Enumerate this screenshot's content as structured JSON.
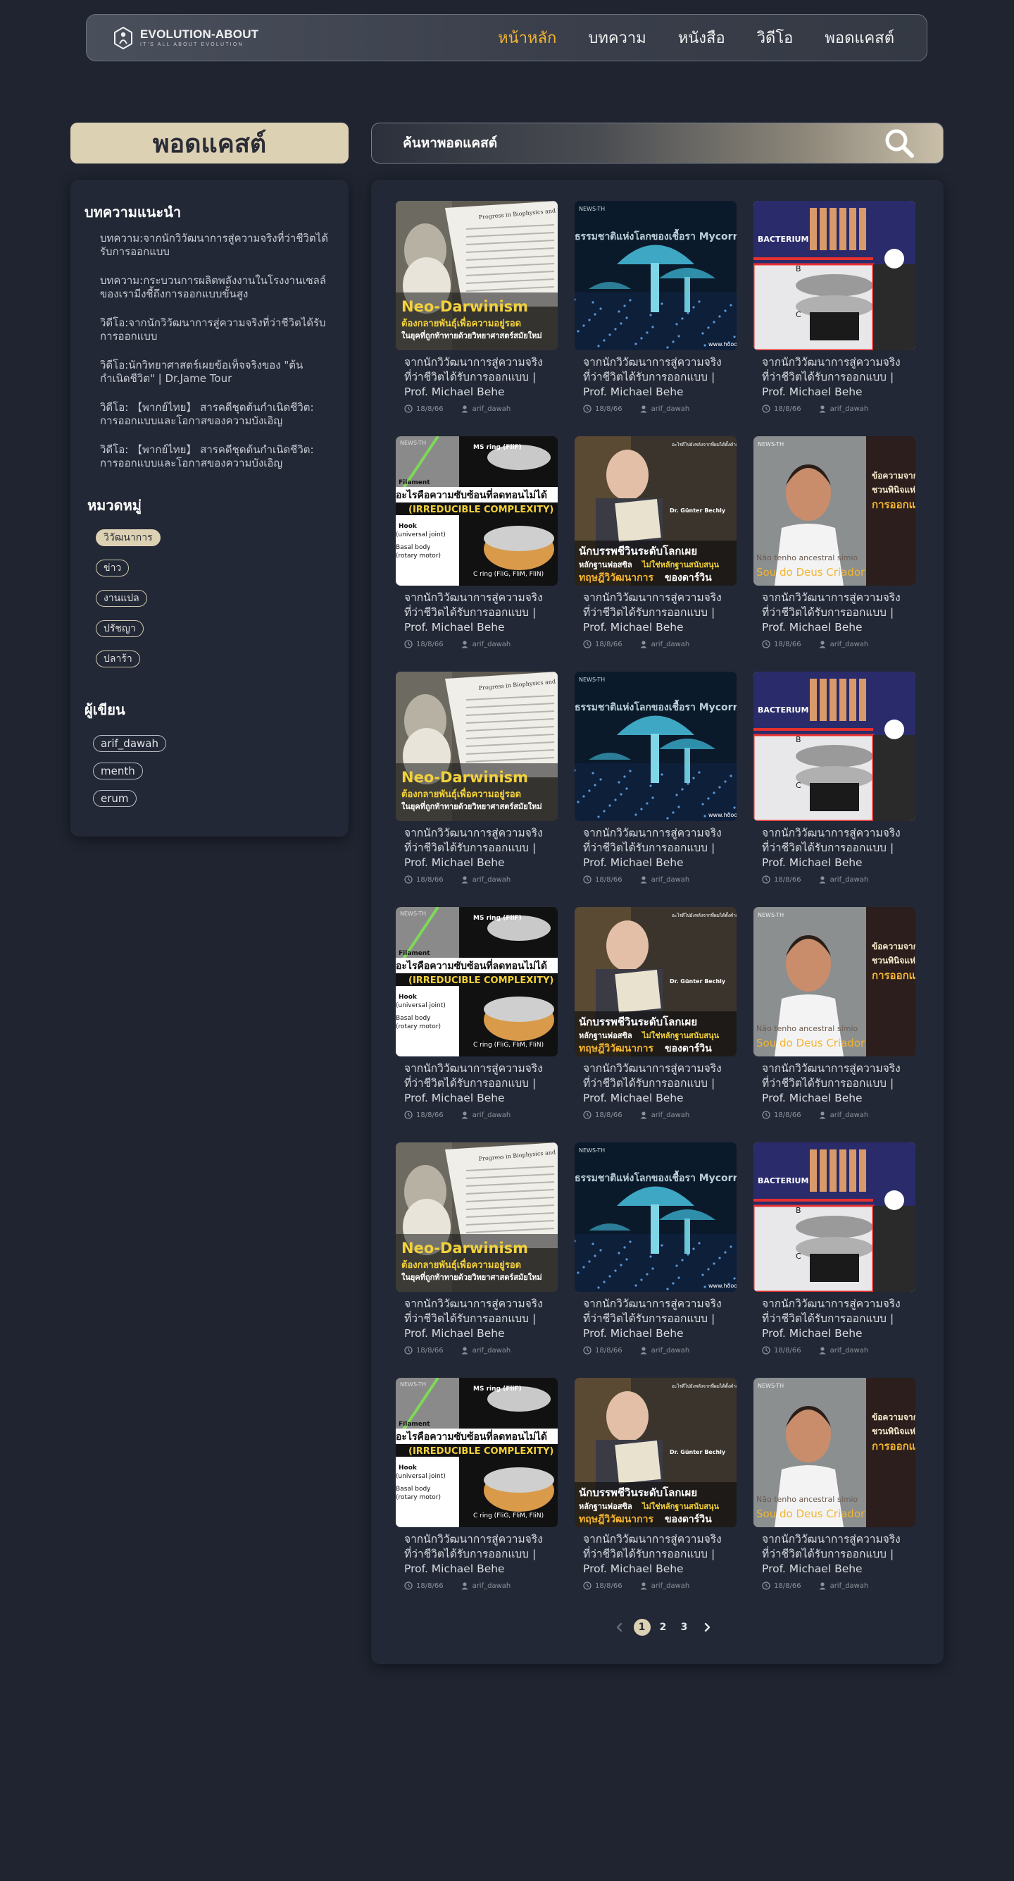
{
  "nav": {
    "logo_name": "EVOLUTION-ABOUT",
    "logo_tagline": "IT'S ALL ABOUT EVOLUTION",
    "links": [
      {
        "label": "หน้าหลัก",
        "active": true
      },
      {
        "label": "บทความ",
        "active": false
      },
      {
        "label": "หนังสือ",
        "active": false
      },
      {
        "label": "วิดีโอ",
        "active": false
      },
      {
        "label": "พอดแคสต์",
        "active": false
      }
    ],
    "active_color": "#f2b431"
  },
  "page": {
    "heading": "พอดแคสต์"
  },
  "search": {
    "placeholder": "ค้นหาพอดแคสต์",
    "icon": "search-icon"
  },
  "sidebar": {
    "recommended_title": "บทความแนะนำ",
    "recommended": [
      "บทความ:จากนักวิวัฒนาการสู่ความจริงที่ว่าชีวิตได้รับการออกแบบ",
      "บทความ:กระบวนการผลิตพลังงานในโรงงานเซลล์ของเรามีงชี้ถึงการออกแบบขั้นสูง",
      "วิดีโอ:จากนักวิวัฒนาการสู่ความจริงที่ว่าชีวิตได้รับการออกแบบ",
      "วิดีโอ:นักวิทยาศาสตร์เผยข้อเท็จจริงของ \"ต้นกำเนิดชีวิต\" | Dr.Jame Tour",
      "วิดีโอ: 【พากย์ไทย】 สารคดีชุดต้นกำเนิดชีวิต: การออกแบบและโอกาสของความบังเอิญ",
      "วิดีโอ: 【พากย์ไทย】 สารคดีชุดต้นกำเนิดชีวิต: การออกแบบและโอกาสของความบังเอิญ"
    ],
    "categories_title": "หมวดหมู่",
    "categories": [
      {
        "label": "วิวัฒนาการ",
        "active": true
      },
      {
        "label": "ข่าว",
        "active": false
      },
      {
        "label": "งานแปล",
        "active": false
      },
      {
        "label": "ปรัชญา",
        "active": false
      },
      {
        "label": "ปลาร้า",
        "active": false
      }
    ],
    "authors_title": "ผู้เขียน",
    "authors": [
      "arif_dawah",
      "menth",
      "erum"
    ],
    "accent_color": "#ddd1b4"
  },
  "cards": [
    {
      "thumb": "darwin",
      "title": "จากนักวิวัฒนาการสู่ความจริงที่ว่าชีวิตได้รับการออกแบบ | Prof. Michael Behe",
      "date": "18/8/66",
      "author": "arif_dawah"
    },
    {
      "thumb": "mushroom",
      "title": "จากนักวิวัฒนาการสู่ความจริงที่ว่าชีวิตได้รับการออกแบบ | Prof. Michael Behe",
      "date": "18/8/66",
      "author": "arif_dawah"
    },
    {
      "thumb": "bacterium",
      "title": "จากนักวิวัฒนาการสู่ความจริงที่ว่าชีวิตได้รับการออกแบบ | Prof. Michael Behe",
      "date": "18/8/66",
      "author": "arif_dawah"
    },
    {
      "thumb": "motor",
      "title": "จากนักวิวัฒนาการสู่ความจริงที่ว่าชีวิตได้รับการออกแบบ | Prof. Michael Behe",
      "date": "18/8/66",
      "author": "arif_dawah"
    },
    {
      "thumb": "bechly",
      "title": "จากนักวิวัฒนาการสู่ความจริงที่ว่าชีวิตได้รับการออกแบบ | Prof. Michael Behe",
      "date": "18/8/66",
      "author": "arif_dawah"
    },
    {
      "thumb": "doctor",
      "title": "จากนักวิวัฒนาการสู่ความจริงที่ว่าชีวิตได้รับการออกแบบ | Prof. Michael Behe",
      "date": "18/8/66",
      "author": "arif_dawah"
    },
    {
      "thumb": "darwin",
      "title": "จากนักวิวัฒนาการสู่ความจริงที่ว่าชีวิตได้รับการออกแบบ | Prof. Michael Behe",
      "date": "18/8/66",
      "author": "arif_dawah"
    },
    {
      "thumb": "mushroom",
      "title": "จากนักวิวัฒนาการสู่ความจริงที่ว่าชีวิตได้รับการออกแบบ | Prof. Michael Behe",
      "date": "18/8/66",
      "author": "arif_dawah"
    },
    {
      "thumb": "bacterium",
      "title": "จากนักวิวัฒนาการสู่ความจริงที่ว่าชีวิตได้รับการออกแบบ | Prof. Michael Behe",
      "date": "18/8/66",
      "author": "arif_dawah"
    },
    {
      "thumb": "motor",
      "title": "จากนักวิวัฒนาการสู่ความจริงที่ว่าชีวิตได้รับการออกแบบ | Prof. Michael Behe",
      "date": "18/8/66",
      "author": "arif_dawah"
    },
    {
      "thumb": "bechly",
      "title": "จากนักวิวัฒนาการสู่ความจริงที่ว่าชีวิตได้รับการออกแบบ | Prof. Michael Behe",
      "date": "18/8/66",
      "author": "arif_dawah"
    },
    {
      "thumb": "doctor",
      "title": "จากนักวิวัฒนาการสู่ความจริงที่ว่าชีวิตได้รับการออกแบบ | Prof. Michael Behe",
      "date": "18/8/66",
      "author": "arif_dawah"
    },
    {
      "thumb": "darwin",
      "title": "จากนักวิวัฒนาการสู่ความจริงที่ว่าชีวิตได้รับการออกแบบ | Prof. Michael Behe",
      "date": "18/8/66",
      "author": "arif_dawah"
    },
    {
      "thumb": "mushroom",
      "title": "จากนักวิวัฒนาการสู่ความจริงที่ว่าชีวิตได้รับการออกแบบ | Prof. Michael Behe",
      "date": "18/8/66",
      "author": "arif_dawah"
    },
    {
      "thumb": "bacterium",
      "title": "จากนักวิวัฒนาการสู่ความจริงที่ว่าชีวิตได้รับการออกแบบ | Prof. Michael Behe",
      "date": "18/8/66",
      "author": "arif_dawah"
    },
    {
      "thumb": "motor",
      "title": "จากนักวิวัฒนาการสู่ความจริงที่ว่าชีวิตได้รับการออกแบบ | Prof. Michael Behe",
      "date": "18/8/66",
      "author": "arif_dawah"
    },
    {
      "thumb": "bechly",
      "title": "จากนักวิวัฒนาการสู่ความจริงที่ว่าชีวิตได้รับการออกแบบ | Prof. Michael Behe",
      "date": "18/8/66",
      "author": "arif_dawah"
    },
    {
      "thumb": "doctor",
      "title": "จากนักวิวัฒนาการสู่ความจริงที่ว่าชีวิตได้รับการออกแบบ | Prof. Michael Behe",
      "date": "18/8/66",
      "author": "arif_dawah"
    }
  ],
  "thumb_text": {
    "darwin": {
      "line1": "Neo-Darwinism",
      "line2": "ต้องกลายพันธุ์เพื่อความอยู่รอด",
      "line3": "ในยุคที่ถูกท้าทายด้วยวิทยาศาสตร์สมัยใหม่",
      "paper": "Progress in Biophysics and Molecular Biology"
    },
    "mushroom": {
      "brand": "NEWS-TH",
      "overlay": "ธรรมชาติแห่งโลกของเชื้อรา Mycorrhizal Network",
      "site": "www.hooo"
    },
    "bacterium": {
      "label": "BACTERIUM",
      "b": "B",
      "c": "C"
    },
    "motor": {
      "brand": "NEWS-TH",
      "title": "อะไรคือความซับซ้อนที่ลดทอนไม่ได้",
      "sub": "(IRREDUCIBLE COMPLEXITY)",
      "l1": "Filament",
      "l2": "Hook",
      "l3": "(universal joint)",
      "l4": "Basal body",
      "l5": "(rotary motor)",
      "ms": "MS ring (FliF)",
      "c": "C ring (FliG, FliM, FliN)"
    },
    "bechly": {
      "quote": "อะไรดีไปยังหลังจากที่ผมได้ตั้งคำถามเกี่ยวกับชีวิตกับวิวัฒนาการมากขึ้นเรื่อย ๆ",
      "name": "Dr. Günter Bechly",
      "title1": "นักบรรพชีวินระดับโลกเผย",
      "title2a": "หลักฐานฟอสซิล",
      "title2b": "ไม่ใช่หลักฐานสนับสนุน",
      "title3a": "ทฤษฎีวิวัฒนาการ",
      "title3b": "ของดาร์วิน"
    },
    "doctor": {
      "brand": "NEWS-TH",
      "side1": "ข้อความจากเซลล์",
      "side2": "ชวนพินิจแห่ง",
      "side3": "การออกแบบ",
      "port1": "Não tenho ancestral símio",
      "port2": "Sou do Deus Criador"
    }
  },
  "pagination": {
    "pages": [
      "1",
      "2",
      "3"
    ],
    "current": "1"
  }
}
